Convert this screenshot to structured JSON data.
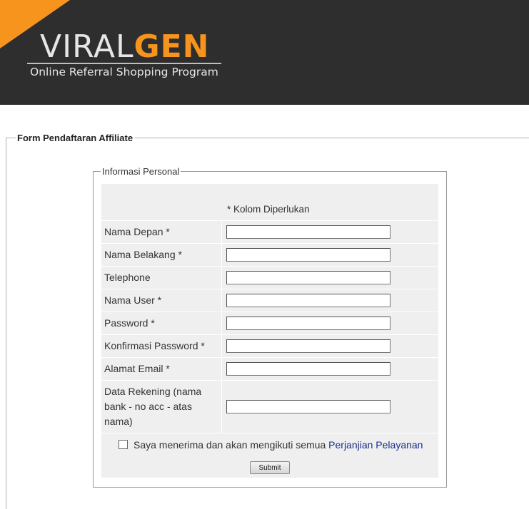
{
  "header": {
    "logo_part1": "VIRAL",
    "logo_part2": "GEN",
    "tagline": "Online Referral Shopping Program",
    "accent_color": "#f7941d",
    "background_color": "#2e2e2e"
  },
  "form": {
    "title": "Form Pendaftaran Affiliate",
    "section_title": "Informasi Personal",
    "required_note": "* Kolom Diperlukan",
    "fields": [
      {
        "label": "Nama Depan *",
        "value": ""
      },
      {
        "label": "Nama Belakang *",
        "value": ""
      },
      {
        "label": "Telephone",
        "value": ""
      },
      {
        "label": "Nama User *",
        "value": ""
      },
      {
        "label": "Password *",
        "value": ""
      },
      {
        "label": "Konfirmasi Password *",
        "value": ""
      },
      {
        "label": "Alamat Email *",
        "value": ""
      },
      {
        "label_lines": [
          "Data Rekening (nama",
          "bank - no acc - atas",
          "nama)"
        ],
        "value": ""
      }
    ],
    "agreement_text": "Saya menerima dan akan mengikuti semua",
    "agreement_link": "Perjanjian Pelayanan",
    "agreement_checked": false,
    "submit_label": "Submit"
  }
}
